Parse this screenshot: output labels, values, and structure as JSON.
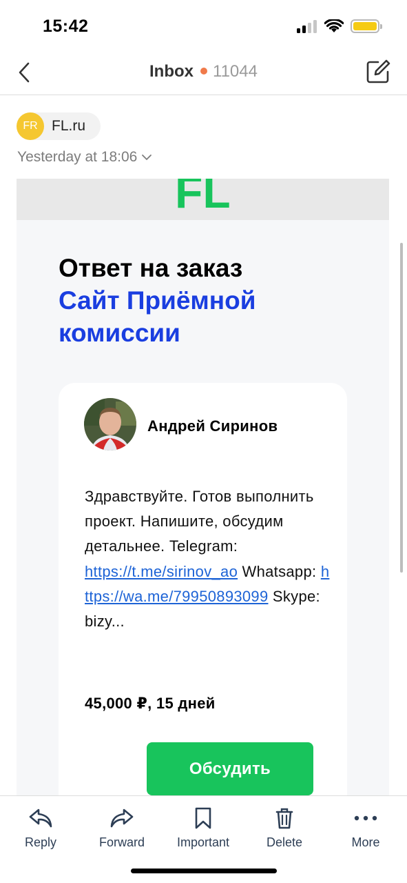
{
  "status_bar": {
    "time": "15:42",
    "battery_color": "#f5cb14"
  },
  "nav": {
    "title": "Inbox",
    "unread_count": "11044",
    "dot_color": "#f07a4a",
    "back_icon": "chevron-left-icon",
    "compose_icon": "compose-icon"
  },
  "email": {
    "sender_initials": "FR",
    "sender_name": "FL.ru",
    "date": "Yesterday at 18:06",
    "logo_text": "FL",
    "headline_line1": "Ответ на заказ",
    "headline_line2": "Сайт Приёмной комиссии",
    "author_name": "Андрей Сиринов",
    "message_text_1": "Здравствуйте. Готов выполнить проект. Напишите, обсудим детальнее. Telegram: ",
    "telegram_link": "https://t.me/sirinov_ao",
    "message_text_2": " Whatsapp: ",
    "whatsapp_link": "https://wa.me/79950893099",
    "message_text_3": " Skype: bizy...",
    "price": "45,000 ₽, 15 дней",
    "discuss_button": "Обсудить",
    "accent_green": "#18c45c",
    "accent_blue": "#1a3ee0"
  },
  "toolbar": {
    "items": [
      {
        "label": "Reply",
        "icon": "reply-icon"
      },
      {
        "label": "Forward",
        "icon": "forward-icon"
      },
      {
        "label": "Important",
        "icon": "bookmark-icon"
      },
      {
        "label": "Delete",
        "icon": "trash-icon"
      },
      {
        "label": "More",
        "icon": "more-icon"
      }
    ]
  }
}
